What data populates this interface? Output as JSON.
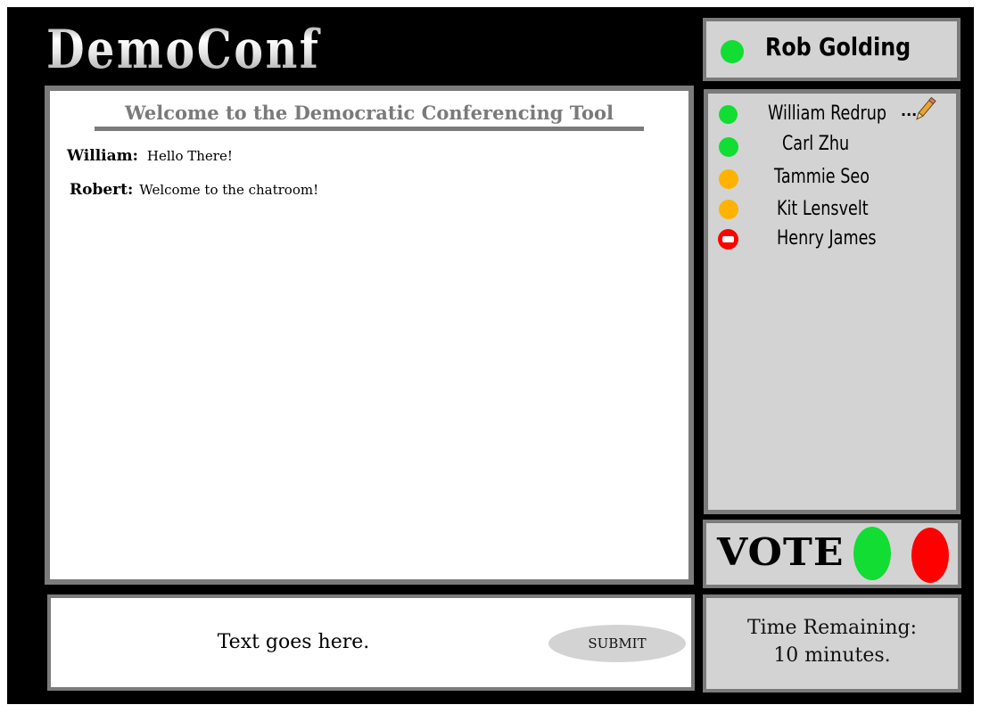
{
  "app": {
    "logo": "DemoConf"
  },
  "chat": {
    "title": "Welcome to the Democratic Conferencing Tool",
    "messages": [
      {
        "sender": "William:",
        "text": "Hello There!"
      },
      {
        "sender": "Robert:",
        "text": "Welcome to the chatroom!"
      }
    ]
  },
  "composer": {
    "placeholder": "Text goes here.",
    "submit_label": "SUBMIT"
  },
  "current_user": {
    "name": "Rob Golding",
    "status": "online"
  },
  "participants": [
    {
      "name": "William Redrup",
      "status": "online",
      "typing_indicator": "..."
    },
    {
      "name": "Carl Zhu",
      "status": "online"
    },
    {
      "name": "Tammie Seo",
      "status": "away"
    },
    {
      "name": "Kit Lensvelt",
      "status": "away"
    },
    {
      "name": "Henry James",
      "status": "busy"
    }
  ],
  "vote": {
    "label": "VOTE",
    "yes_color": "#11dd33",
    "no_color": "#ff0000"
  },
  "timer": {
    "label": "Time Remaining:",
    "value": "10 minutes."
  },
  "colors": {
    "online": "#11dd33",
    "away": "#ffb300",
    "busy": "#ff0000",
    "panel": "#d3d3d3",
    "border": "#7b7b7b"
  }
}
